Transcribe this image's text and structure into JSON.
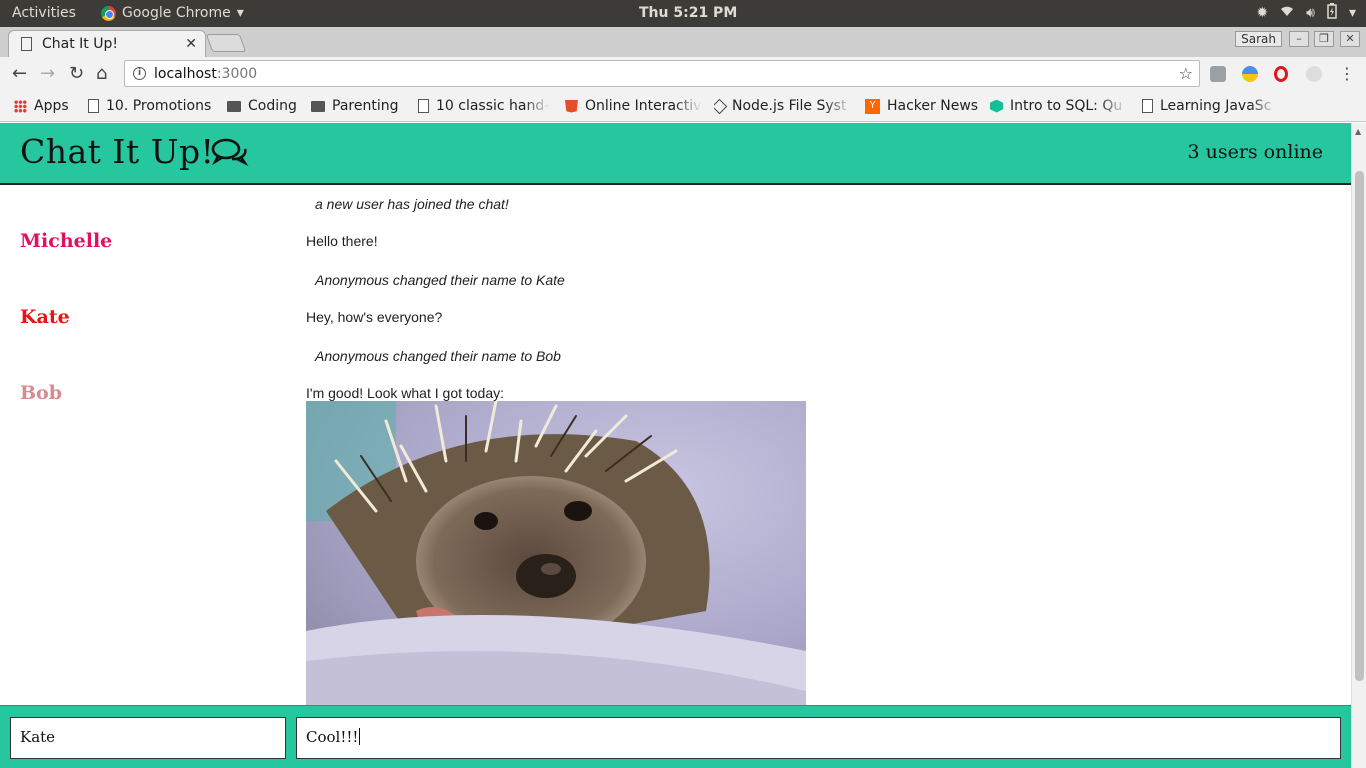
{
  "os": {
    "activities": "Activities",
    "app_name": "Google Chrome",
    "clock": "Thu  5:21 PM"
  },
  "browser": {
    "tab_title": "Chat It Up!",
    "profile": "Sarah",
    "url_host": "localhost",
    "url_port": ":3000",
    "bookmarks": [
      {
        "label": "Apps",
        "icon": "apps-grid-icon"
      },
      {
        "label": "10. Promotions",
        "icon": "page-icon"
      },
      {
        "label": "Coding",
        "icon": "folder-icon"
      },
      {
        "label": "Parenting",
        "icon": "folder-icon"
      },
      {
        "label": "10 classic hand-c",
        "icon": "page-icon"
      },
      {
        "label": "Online Interactiv",
        "icon": "html5-icon"
      },
      {
        "label": "Node.js File Syst",
        "icon": "nodejs-icon"
      },
      {
        "label": "Hacker News",
        "icon": "hackernews-icon"
      },
      {
        "label": "Intro to SQL: Qu",
        "icon": "khan-icon"
      },
      {
        "label": "Learning JavaSc",
        "icon": "page-icon"
      }
    ]
  },
  "app": {
    "title": "Chat It Up!",
    "online": "3 users online"
  },
  "messages": [
    {
      "type": "system",
      "text": "a new user has joined the chat!"
    },
    {
      "type": "user",
      "name": "Michelle",
      "name_color": "#e0115f",
      "text": "Hello there!"
    },
    {
      "type": "system",
      "text": "Anonymous changed their name to Kate"
    },
    {
      "type": "user",
      "name": "Kate",
      "name_color": "#ee1111",
      "text": "Hey, how's everyone?"
    },
    {
      "type": "system",
      "text": "Anonymous changed their name to Bob"
    },
    {
      "type": "user",
      "name": "Bob",
      "name_color": "#d98a8f",
      "text": "I'm good! Look what I got today:",
      "image": "hedgehog-photo"
    }
  ],
  "composer": {
    "name_value": "Kate",
    "message_value": "Cool!!!"
  },
  "colors": {
    "accent": "#26c69e"
  }
}
